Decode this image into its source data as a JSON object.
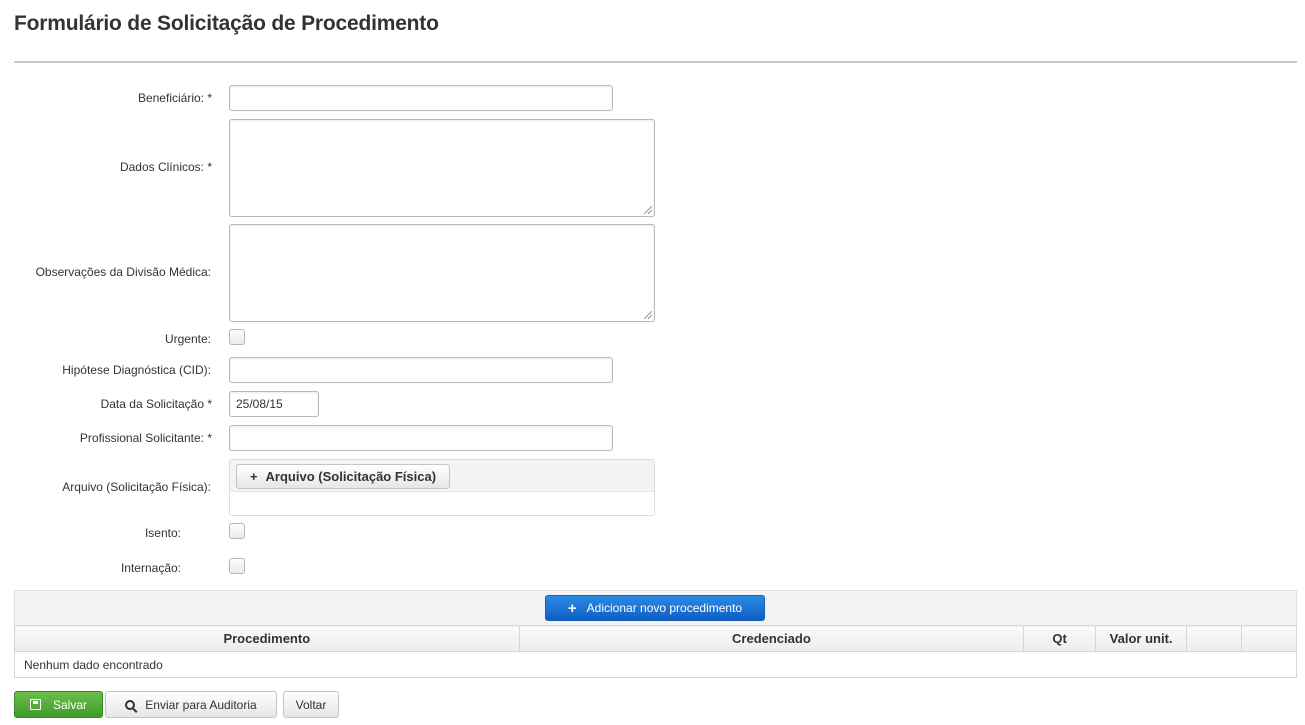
{
  "page": {
    "title": "Formulário de Solicitação de Procedimento"
  },
  "form": {
    "beneficiario": {
      "label": "Beneficiário: *",
      "value": ""
    },
    "dados_clinicos": {
      "label": "Dados Clínicos: *"
    },
    "observacoes": {
      "label": "Observações da Divisão Médica:"
    },
    "urgente": {
      "label": "Urgente:",
      "checked": false
    },
    "hipotese": {
      "label": "Hipótese Diagnóstica (CID):",
      "value": ""
    },
    "data_solicitacao": {
      "label": "Data da Solicitação *",
      "value": "25/08/15"
    },
    "profissional": {
      "label": "Profissional Solicitante: *",
      "value": ""
    },
    "arquivo": {
      "label": "Arquivo (Solicitação Física):",
      "button_label": "Arquivo (Solicitação Física)"
    },
    "isento": {
      "label": "Isento:",
      "checked": false
    },
    "internacao": {
      "label": "Internação:",
      "checked": false
    }
  },
  "procedures": {
    "add_button_label": "Adicionar novo procedimento",
    "columns": [
      "Procedimento",
      "Credenciado",
      "Qt",
      "Valor unit.",
      "",
      ""
    ],
    "empty_message": "Nenhum dado encontrado"
  },
  "actions": {
    "save_label": "Salvar",
    "audit_label": "Enviar para Auditoria",
    "back_label": "Voltar"
  },
  "colors": {
    "primary": "#0f5fc4",
    "success": "#3f9a2b"
  },
  "icons": {
    "plus": "plus-icon",
    "save": "floppy-disk-icon",
    "search": "search-icon"
  }
}
